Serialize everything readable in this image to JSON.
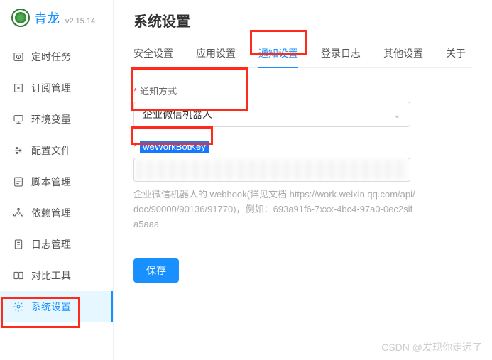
{
  "brand": {
    "name": "青龙",
    "version": "v2.15.14"
  },
  "sidebar": {
    "items": [
      {
        "label": "定时任务",
        "icon": "clock"
      },
      {
        "label": "订阅管理",
        "icon": "plus-square"
      },
      {
        "label": "环境变量",
        "icon": "monitor"
      },
      {
        "label": "配置文件",
        "icon": "sliders"
      },
      {
        "label": "脚本管理",
        "icon": "file"
      },
      {
        "label": "依赖管理",
        "icon": "deps"
      },
      {
        "label": "日志管理",
        "icon": "log"
      },
      {
        "label": "对比工具",
        "icon": "compare"
      },
      {
        "label": "系统设置",
        "icon": "gear",
        "active": true
      }
    ]
  },
  "page": {
    "title": "系统设置"
  },
  "tabs": [
    {
      "label": "安全设置"
    },
    {
      "label": "应用设置"
    },
    {
      "label": "通知设置",
      "active": true
    },
    {
      "label": "登录日志"
    },
    {
      "label": "其他设置"
    },
    {
      "label": "关于"
    }
  ],
  "form": {
    "method_label": "通知方式",
    "method_value": "企业微信机器人",
    "field_name": "weWorkBotKey",
    "hint": "企业微信机器人的 webhook(详见文档 https://work.weixin.qq.com/api/doc/90000/90136/91770)，例如：693a91f6-7xxx-4bc4-97a0-0ec2sifa5aaa",
    "save": "保存"
  },
  "watermark": "CSDN @发现你走远了"
}
